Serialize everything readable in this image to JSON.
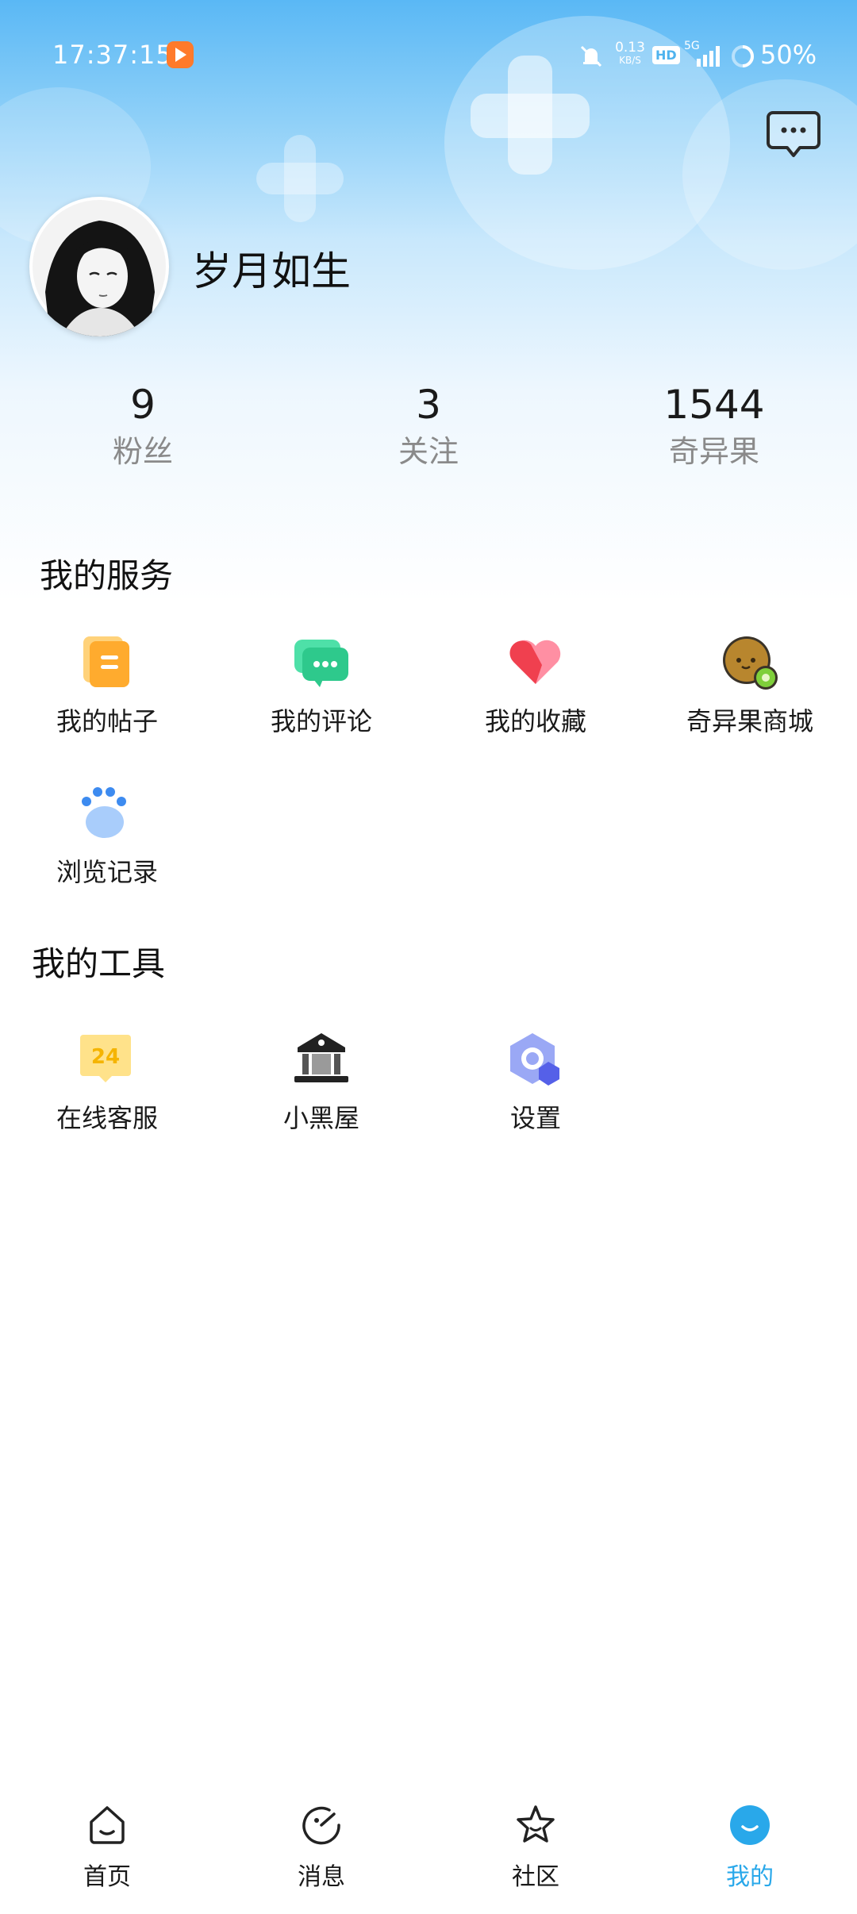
{
  "status_bar": {
    "time": "17:37:15",
    "net_speed": "0.13",
    "net_unit": "KB/S",
    "hd": "HD",
    "network": "5G",
    "battery": "50%"
  },
  "profile": {
    "username": "岁月如生"
  },
  "stats": [
    {
      "value": "9",
      "label": "粉丝"
    },
    {
      "value": "3",
      "label": "关注"
    },
    {
      "value": "1544",
      "label": "奇异果"
    }
  ],
  "services": {
    "title": "我的服务",
    "items": [
      {
        "label": "我的帖子",
        "icon": "posts-icon"
      },
      {
        "label": "我的评论",
        "icon": "comments-icon"
      },
      {
        "label": "我的收藏",
        "icon": "favorites-icon"
      },
      {
        "label": "奇异果商城",
        "icon": "kiwi-shop-icon"
      },
      {
        "label": "浏览记录",
        "icon": "history-icon"
      }
    ]
  },
  "tools": {
    "title": "我的工具",
    "items": [
      {
        "label": "在线客服",
        "icon": "support-24-icon",
        "badge": "24"
      },
      {
        "label": "小黑屋",
        "icon": "blackroom-icon"
      },
      {
        "label": "设置",
        "icon": "settings-icon"
      }
    ]
  },
  "tabbar": [
    {
      "label": "首页",
      "icon": "home-icon"
    },
    {
      "label": "消息",
      "icon": "message-icon"
    },
    {
      "label": "社区",
      "icon": "community-star-icon"
    },
    {
      "label": "我的",
      "icon": "profile-icon",
      "active": true
    }
  ],
  "colors": {
    "accent": "#29a8ea",
    "header_top": "#5ab8f5",
    "stat_label": "#8a8a8a"
  }
}
